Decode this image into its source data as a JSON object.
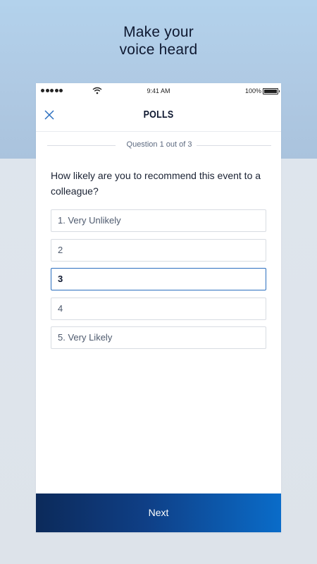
{
  "headline": {
    "line1": "Make your",
    "line2": "voice heard"
  },
  "status_bar": {
    "time": "9:41 AM",
    "battery": "100%"
  },
  "navbar": {
    "title": "POLLS",
    "close_icon": "close-icon"
  },
  "poll": {
    "progress": "Question 1 out of 3",
    "question": "How likely are you to recommend this event to a colleague?",
    "options": [
      {
        "label": "1. Very Unlikely"
      },
      {
        "label": "2"
      },
      {
        "label": "3"
      },
      {
        "label": "4"
      },
      {
        "label": "5. Very Likely"
      }
    ],
    "selected_index": 2
  },
  "footer": {
    "next_label": "Next"
  },
  "colors": {
    "accent": "#2b6fbf",
    "button_gradient_start": "#0c2a5a",
    "button_gradient_end": "#0a6cc9"
  }
}
